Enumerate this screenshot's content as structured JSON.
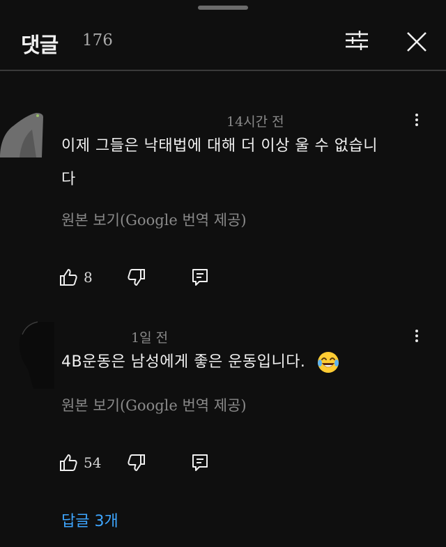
{
  "header": {
    "title": "댓글",
    "comment_count": "176"
  },
  "comments": [
    {
      "time": "14시간 전",
      "text": "이제 그들은 낙태법에 대해 더 이상 울 수 없습니다",
      "translate_link": "원본 보기(Google 번역 제공)",
      "like_count": "8"
    },
    {
      "time": "1일 전",
      "text": "4B운동은 남성에게 좋은 운동입니다.",
      "emoji": "😂",
      "translate_link": "원본 보기(Google 번역 제공)",
      "like_count": "54",
      "replies_label": "답글 3개"
    }
  ],
  "colors": {
    "background": "#0f0f0f",
    "text_primary": "#f1f1f1",
    "text_secondary": "#8a8a8a",
    "link_blue": "#3ea6ff"
  },
  "icons": {
    "filter": "sliders-icon",
    "close": "close-icon",
    "more": "more-vertical-icon",
    "like": "thumbs-up-icon",
    "dislike": "thumbs-down-icon",
    "reply": "reply-comment-icon"
  }
}
